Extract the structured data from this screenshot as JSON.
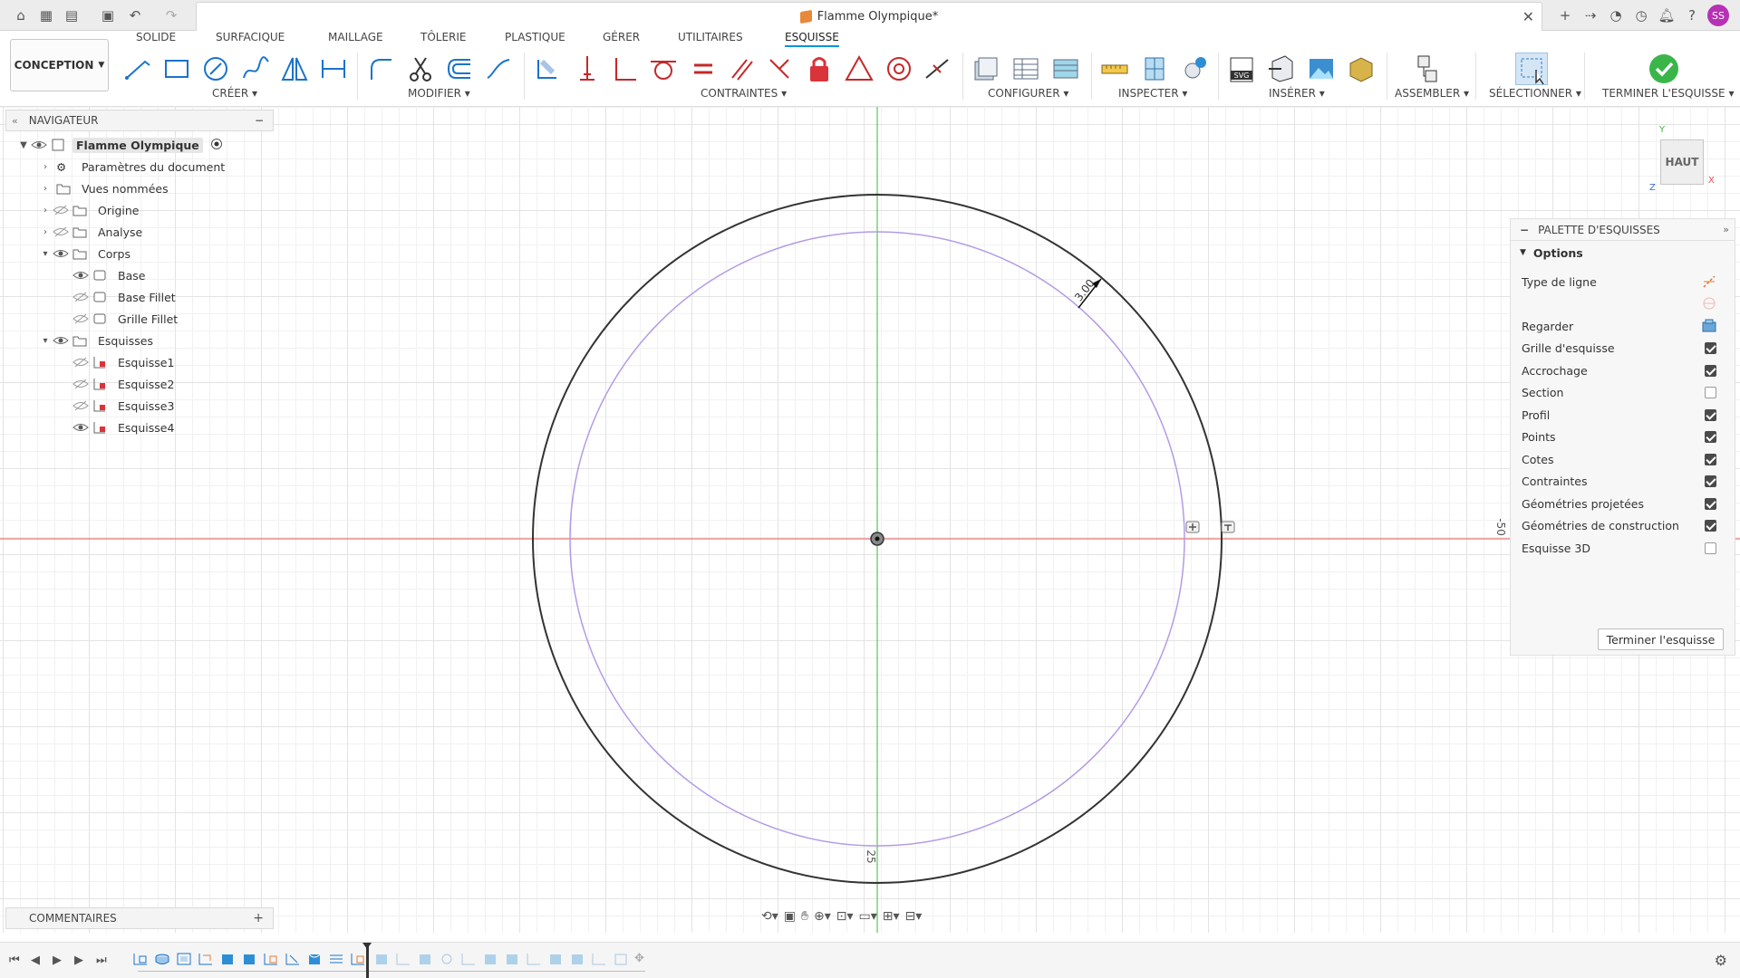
{
  "window": {
    "doc_title": "Flamme Olympique*",
    "user_initials": "SS"
  },
  "toolbar": {
    "workspace_label": "CONCEPTION",
    "tabs": [
      "SOLIDE",
      "SURFACIQUE",
      "MAILLAGE",
      "TÔLERIE",
      "PLASTIQUE",
      "GÉRER",
      "UTILITAIRES",
      "ESQUISSE"
    ],
    "active_tab": "ESQUISSE",
    "groups": {
      "creer": "CRÉER",
      "modifier": "MODIFIER",
      "contraintes": "CONTRAINTES",
      "configurer": "CONFIGURER",
      "inspecter": "INSPECTER",
      "inserer": "INSÉRER",
      "assembler": "ASSEMBLER",
      "selectionner": "SÉLECTIONNER",
      "terminer": "TERMINER L'ESQUISSE"
    },
    "accent": "#0696d7"
  },
  "navigator": {
    "title": "NAVIGATEUR",
    "root": "Flamme Olympique",
    "items": [
      {
        "label": "Paramètres du document"
      },
      {
        "label": "Vues nommées"
      },
      {
        "label": "Origine"
      },
      {
        "label": "Analyse"
      },
      {
        "label": "Corps"
      },
      {
        "label": "Base"
      },
      {
        "label": "Base Fillet"
      },
      {
        "label": "Grille Fillet"
      },
      {
        "label": "Esquisses"
      },
      {
        "label": "Esquisse1"
      },
      {
        "label": "Esquisse2"
      },
      {
        "label": "Esquisse3"
      },
      {
        "label": "Esquisse4"
      }
    ]
  },
  "comments": {
    "title": "COMMENTAIRES"
  },
  "palette": {
    "title": "PALETTE D'ESQUISSES",
    "section": "Options",
    "rows": [
      {
        "label": "Type de ligne",
        "control": "line-type-icon"
      },
      {
        "label": "Regarder",
        "control": "look-at-icon"
      },
      {
        "label": "Grille d'esquisse",
        "checked": true
      },
      {
        "label": "Accrochage",
        "checked": true
      },
      {
        "label": "Section",
        "checked": false
      },
      {
        "label": "Profil",
        "checked": true
      },
      {
        "label": "Points",
        "checked": true
      },
      {
        "label": "Cotes",
        "checked": true
      },
      {
        "label": "Contraintes",
        "checked": true
      },
      {
        "label": "Géométries projetées",
        "checked": true
      },
      {
        "label": "Géométries de construction",
        "checked": true
      },
      {
        "label": "Esquisse 3D",
        "checked": false
      }
    ],
    "finish_button": "Terminer l'esquisse"
  },
  "viewcube": {
    "face": "HAUT",
    "axis_x": "X",
    "axis_y": "Y",
    "axis_z": "Z"
  },
  "sketch": {
    "dimension_radial": "3.00",
    "dimension_bottom": "25",
    "dimension_right": "-50",
    "outer_color": "#333333",
    "inner_color": "#b49be6",
    "axis_x_color": "#e05050",
    "axis_y_color": "#3cb43c"
  }
}
